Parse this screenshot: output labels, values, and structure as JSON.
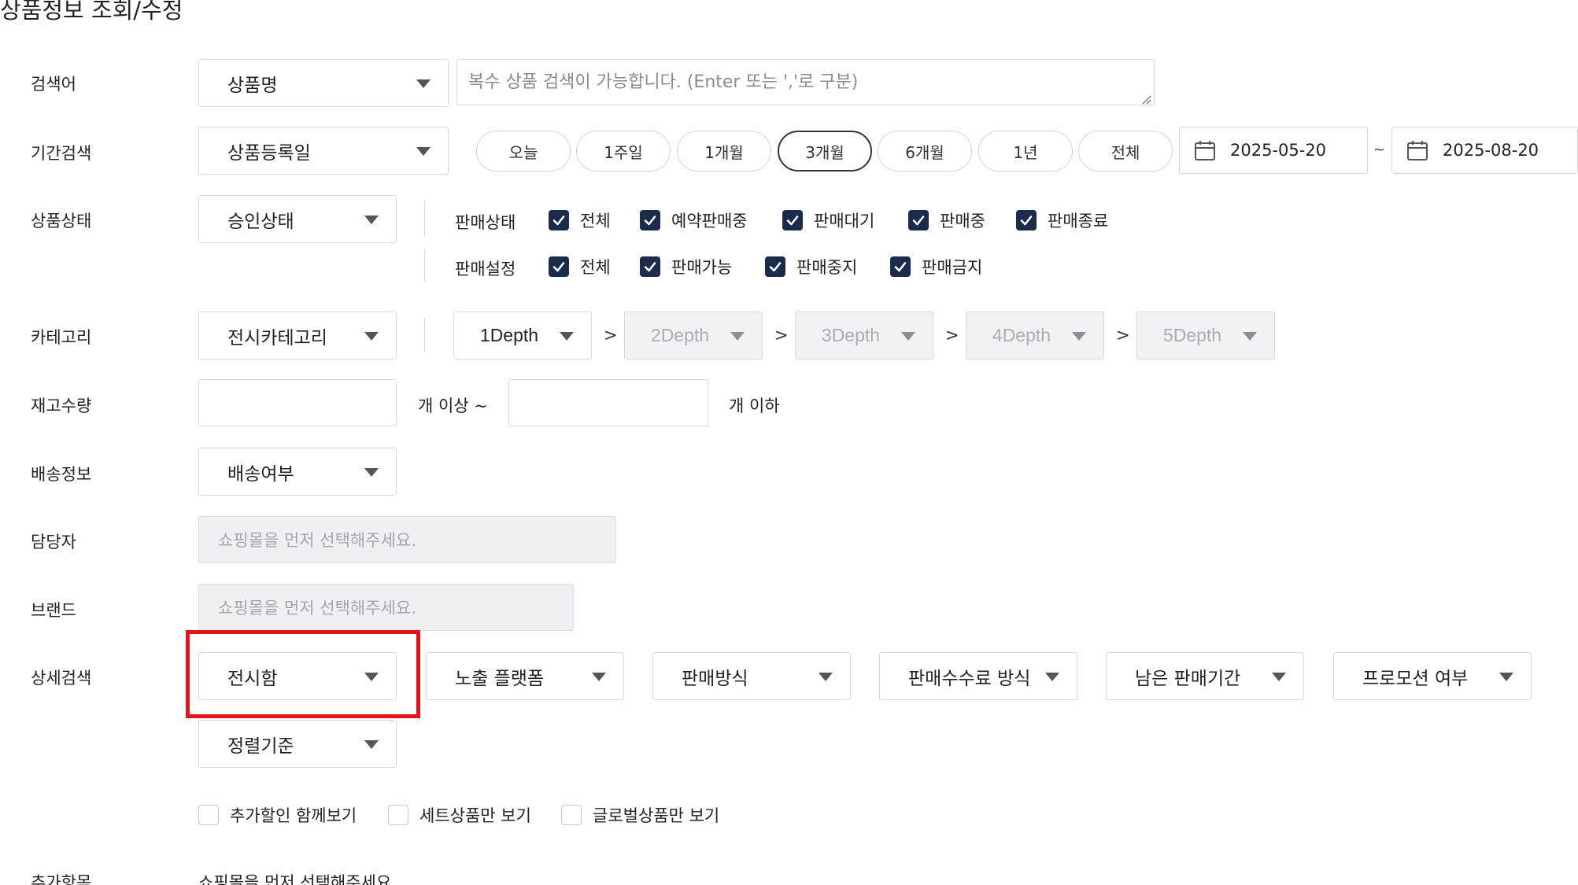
{
  "page": {
    "title": "상품정보 조회/수정"
  },
  "labels": {
    "keyword": "검색어",
    "period": "기간검색",
    "status": "상품상태",
    "category": "카테고리",
    "stock": "재고수량",
    "shipping": "배송정보",
    "manager": "담당자",
    "brand": "브랜드",
    "detail": "상세검색",
    "extra": "추가항목"
  },
  "keyword": {
    "select_value": "상품명",
    "placeholder": "복수 상품 검색이 가능합니다. (Enter 또는 ','로 구분)"
  },
  "period": {
    "select_value": "상품등록일",
    "presets": [
      "오늘",
      "1주일",
      "1개월",
      "3개월",
      "6개월",
      "1년",
      "전체"
    ],
    "active_preset": "3개월",
    "start_date": "2025-05-20",
    "separator": "~",
    "end_date": "2025-08-20"
  },
  "status": {
    "select_value": "승인상태",
    "sale_status_label": "판매상태",
    "sale_status_items": [
      "전체",
      "예약판매중",
      "판매대기",
      "판매중",
      "판매종료"
    ],
    "sale_setting_label": "판매설정",
    "sale_setting_items": [
      "전체",
      "판매가능",
      "판매중지",
      "판매금지"
    ]
  },
  "category": {
    "select_value": "전시카테고리",
    "depths": [
      "1Depth",
      "2Depth",
      "3Depth",
      "4Depth",
      "5Depth"
    ],
    "separator": ">"
  },
  "stock": {
    "min_value": "",
    "min_suffix": "개 이상 ~",
    "max_value": "",
    "max_suffix": "개 이하"
  },
  "shipping": {
    "select_value": "배송여부"
  },
  "manager": {
    "placeholder": "쇼핑몰을 먼저 선택해주세요."
  },
  "brand": {
    "placeholder": "쇼핑몰을 먼저 선택해주세요."
  },
  "detail": {
    "selects": [
      "전시함",
      "노출 플랫폼",
      "판매방식",
      "판매수수료 방식",
      "남은 판매기간",
      "프로모션 여부"
    ],
    "sort_select": "정렬기준",
    "options": [
      "추가할인 함께보기",
      "세트상품만 보기",
      "글로벌상품만 보기"
    ]
  },
  "extra": {
    "message": "쇼핑몰을 먼저 선택해주세요."
  },
  "colors": {
    "checkbox": "#1a2b4c",
    "highlight": "#e0141e"
  }
}
